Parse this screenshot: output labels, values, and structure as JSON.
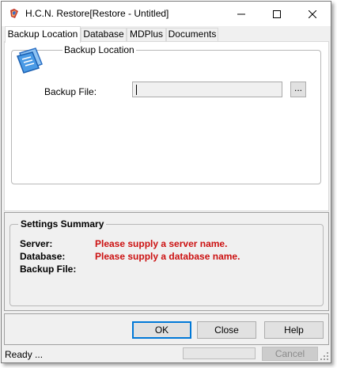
{
  "window": {
    "title": "H.C.N. Restore[Restore - Untitled]",
    "controls": {
      "minimize": "minimize",
      "maximize": "maximize",
      "close": "close"
    }
  },
  "tabs": [
    {
      "label": "Backup Location",
      "active": true
    },
    {
      "label": "Database",
      "active": false
    },
    {
      "label": "MDPlus",
      "active": false
    },
    {
      "label": "Documents",
      "active": false
    }
  ],
  "backup_location": {
    "group_title": "Backup Location",
    "file_label": "Backup File:",
    "file_value": "",
    "browse_label": "..."
  },
  "summary": {
    "title": "Settings Summary",
    "rows": [
      {
        "label": "Server:",
        "value": "Please supply a server name."
      },
      {
        "label": "Database:",
        "value": "Please supply a database name."
      },
      {
        "label": "Backup File:",
        "value": ""
      }
    ],
    "error_color": "#cc1111"
  },
  "buttons": {
    "ok": "OK",
    "close": "Close",
    "help": "Help"
  },
  "status": {
    "text": "Ready ...",
    "cancel": "Cancel"
  }
}
